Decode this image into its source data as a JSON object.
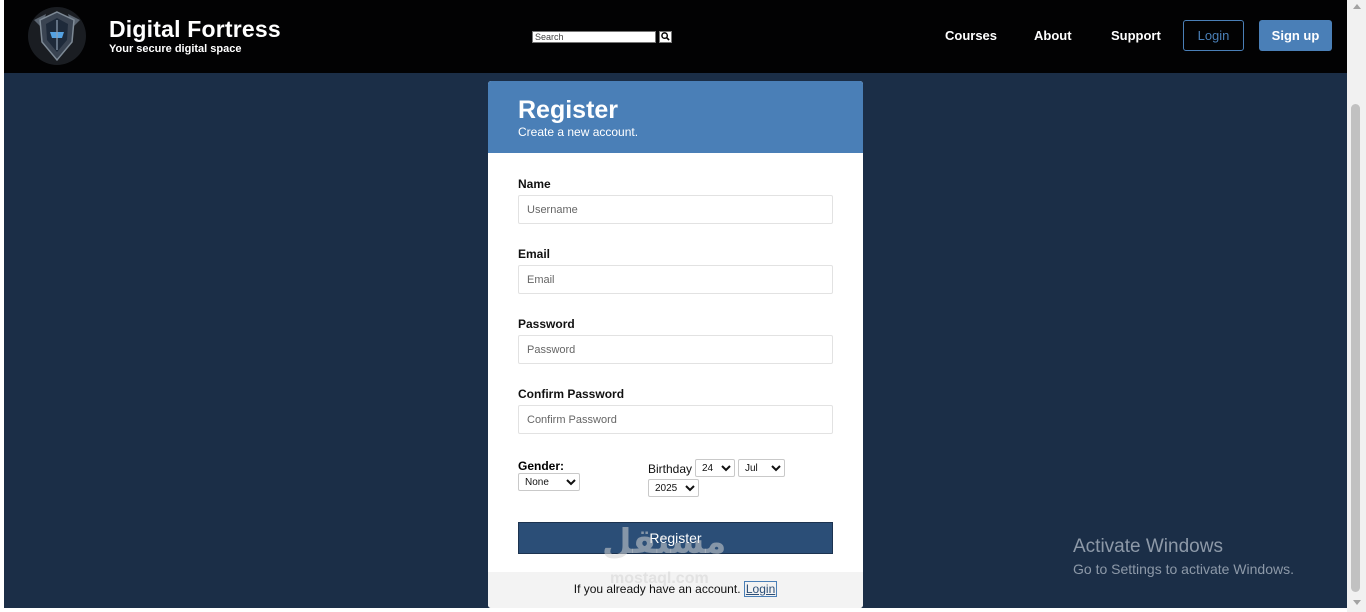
{
  "header": {
    "brand_title": "Digital Fortress",
    "brand_subtitle": "Your secure digital space",
    "logo_icon": "shield-knight-icon",
    "search_placeholder": "Search",
    "nav": {
      "courses": "Courses",
      "about": "About",
      "support": "Support"
    },
    "login_label": "Login",
    "signup_label": "Sign up"
  },
  "card": {
    "title": "Register",
    "subtitle": "Create a new account.",
    "fields": {
      "name_label": "Name",
      "name_placeholder": "Username",
      "email_label": "Email",
      "email_placeholder": "Email",
      "password_label": "Password",
      "password_placeholder": "Password",
      "confirm_label": "Confirm Password",
      "confirm_placeholder": "Confirm Password"
    },
    "gender_label": "Gender:",
    "gender_value": "None",
    "birthday_label": "Birthday",
    "birthday_day": "24",
    "birthday_month": "Jul",
    "birthday_year": "2025",
    "register_label": "Register",
    "footer_text": "If you already have an account.",
    "footer_link": "Login"
  },
  "watermark": {
    "text": "مستقل",
    "sub": "mostaql.com"
  },
  "windows_activation": {
    "title": "Activate Windows",
    "subtitle": "Go to Settings to activate Windows."
  },
  "colors": {
    "page_bg": "#1b2e47",
    "header_bg": "#020203",
    "accent": "#4a7fb7",
    "button_dark": "#2b4e77"
  }
}
